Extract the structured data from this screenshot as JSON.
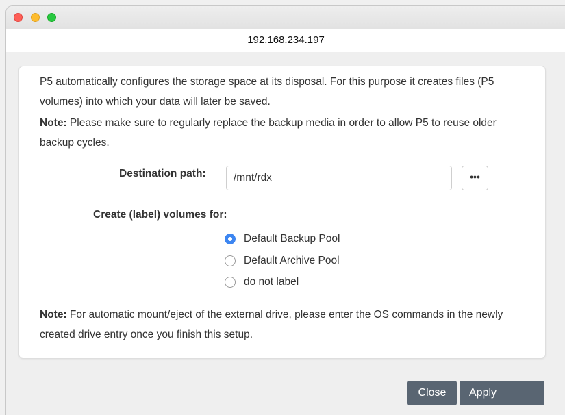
{
  "window": {
    "title": "192.168.234.197"
  },
  "intro": "P5 automatically configures the storage space at its disposal. For this purpose it creates files (P5 volumes) into which your data will later be saved.",
  "note1": {
    "label": "Note:",
    "text": " Please make sure to regularly replace the backup media in order to allow P5 to reuse older backup cycles."
  },
  "destination": {
    "label": "Destination path:",
    "value": "/mnt/rdx",
    "browse_label": "•••"
  },
  "volumes": {
    "label": "Create (label) volumes for:",
    "options": [
      {
        "label": "Default Backup Pool",
        "selected": true
      },
      {
        "label": "Default Archive Pool",
        "selected": false
      },
      {
        "label": "do not label",
        "selected": false
      }
    ]
  },
  "note2": {
    "label": "Note:",
    "text": " For automatic mount/eject of the external drive, please enter the OS commands in the newly created drive entry once you finish this setup."
  },
  "buttons": {
    "close": "Close",
    "apply": "Apply"
  },
  "colors": {
    "radio_selected": "#3d86f1",
    "button_bg": "#596572",
    "close_light": "#fe5f57",
    "minimize_light": "#febc2e",
    "zoom_light": "#28c840"
  }
}
